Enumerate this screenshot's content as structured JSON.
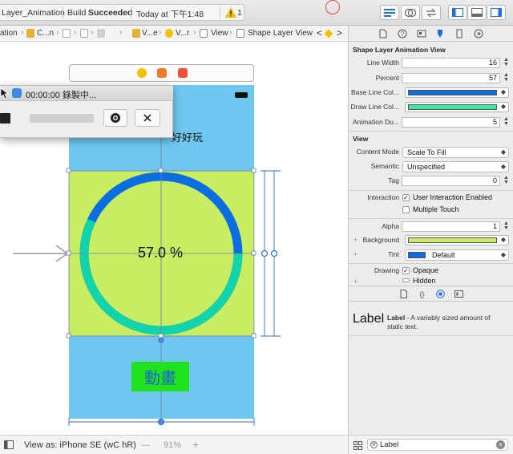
{
  "toolbar": {
    "scheme_name": "Layer_Animation",
    "build_status_prefix": "Build",
    "build_status": "Succeeded",
    "build_time": "Today at 下午1:48",
    "warning_count": "1"
  },
  "jumpbar": {
    "items": [
      "ation",
      "C...n",
      "V...e",
      "V...r",
      "View",
      "Shape Layer View"
    ],
    "nav_prev": "<",
    "nav_next": ">"
  },
  "canvas": {
    "title_label": "好好玩",
    "percent_label": "57.0 %",
    "button_label": "動畫",
    "progress_percent": 57,
    "colors": {
      "top_bg": "#6fc7ef",
      "mid_bg": "#c8ec62",
      "ring_base": "#0a6ee0",
      "ring_progress": "#12d3aa"
    }
  },
  "recorder": {
    "title": "00:00:00 錄製中..."
  },
  "bottombar": {
    "view_as": "View as: iPhone SE (wC hR)",
    "minus": "—",
    "zoom": "91%",
    "plus": "+"
  },
  "inspector": {
    "section_custom": "Shape Layer Animation View",
    "line_width_label": "Line Width",
    "line_width_value": "16",
    "percent_label": "Percent",
    "percent_value": "57",
    "base_color_label": "Base Line Col...",
    "draw_color_label": "Draw Line Col...",
    "anim_duration_label": "Animation Du...",
    "anim_duration_value": "5",
    "section_view": "View",
    "content_mode_label": "Content Mode",
    "content_mode_value": "Scale To Fill",
    "semantic_label": "Semantic",
    "semantic_value": "Unspecified",
    "tag_label": "Tag",
    "tag_value": "0",
    "interaction_label": "Interaction",
    "user_interaction_label": "User Interaction Enabled",
    "multiple_touch_label": "Multiple Touch",
    "alpha_label": "Alpha",
    "alpha_value": "1",
    "background_label": "Background",
    "tint_label": "Tint",
    "tint_value": "Default",
    "drawing_label": "Drawing",
    "opaque_label": "Opaque",
    "hidden_label": "Hidden",
    "colors": {
      "base_line": "#0a6ee0",
      "draw_line": "#3ee89a",
      "background": "#c8ec62",
      "tint": "#0a6ee0"
    }
  },
  "library": {
    "item_name": "Label",
    "item_desc_bold": "Label",
    "item_desc": " - A variably sized amount of static text.",
    "filter_value": "Label"
  }
}
